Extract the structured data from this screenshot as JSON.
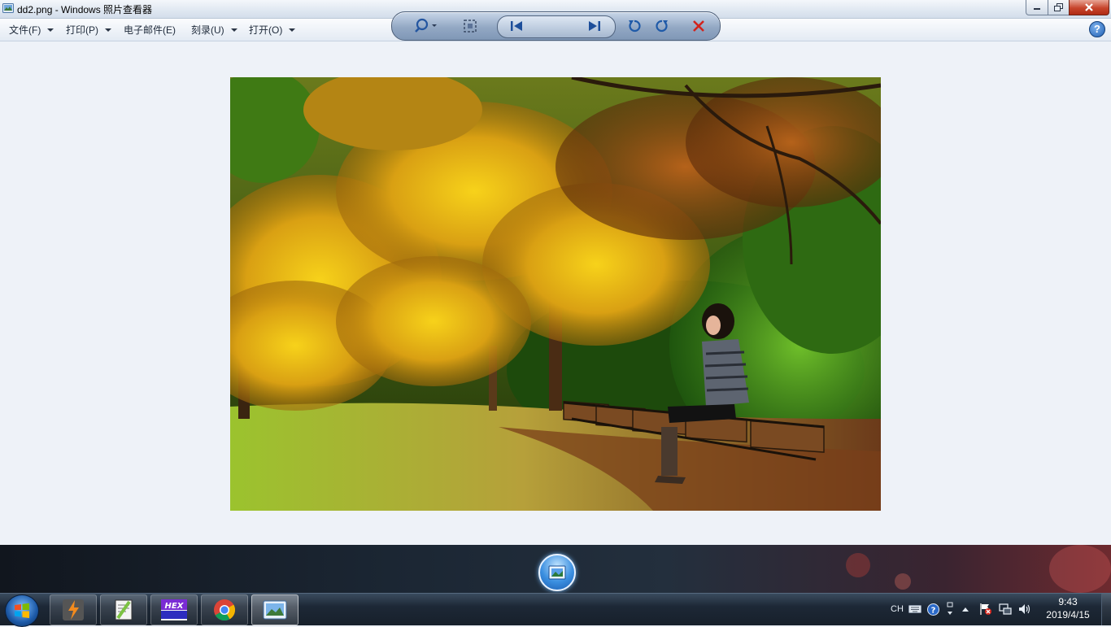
{
  "window": {
    "title": "dd2.png - Windows 照片查看器",
    "icon": "photo-viewer-icon"
  },
  "menu": {
    "file": "文件(F)",
    "print": "打印(P)",
    "email": "电子邮件(E)",
    "burn": "刻录(U)",
    "open": "打开(O)",
    "help": "?"
  },
  "photo": {
    "subject": "woman on park bench under autumn trees",
    "icon": "photo-content"
  },
  "controls": {
    "zoom": "zoom-icon",
    "fit": "actual-size-icon",
    "previous": "previous-icon",
    "slideshow": "slideshow-icon",
    "next": "next-icon",
    "rotate_ccw": "rotate-counterclockwise-icon",
    "rotate_cw": "rotate-clockwise-icon",
    "delete": "delete-icon"
  },
  "taskbar": {
    "apps": [
      "app-orange-bolt-icon",
      "notepad-plus-icon",
      "hex-editor-icon",
      "chrome-icon",
      "photo-viewer-icon"
    ],
    "tray": {
      "lang": "CH",
      "time": "9:43",
      "date": "2019/4/15"
    }
  },
  "colors": {
    "titlebar": "#dfe7f1",
    "viewer_bg": "#eef2f8",
    "accent": "#1f5fb3",
    "close": "#c7452c"
  }
}
